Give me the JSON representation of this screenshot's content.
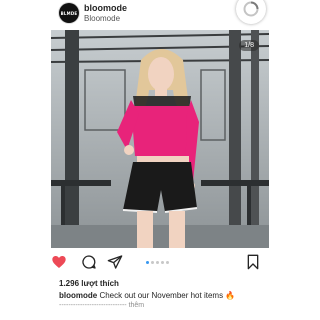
{
  "header": {
    "avatar_text": "BLMDE",
    "username": "bloomode",
    "subname": "Bloomode"
  },
  "photo": {
    "counter": "1/8"
  },
  "actions": {
    "icons": [
      "heart-icon",
      "comment-icon",
      "share-icon",
      "bookmark-icon"
    ],
    "like_color": "#ed4956",
    "page_count": 5,
    "active_page": 1
  },
  "post": {
    "likes": "1.296 lượt thích",
    "caption_user": "bloomode",
    "caption_text": "Check out our November hot items 🔥",
    "caption_dashes": "-----------------------------",
    "more_label": "thêm"
  }
}
